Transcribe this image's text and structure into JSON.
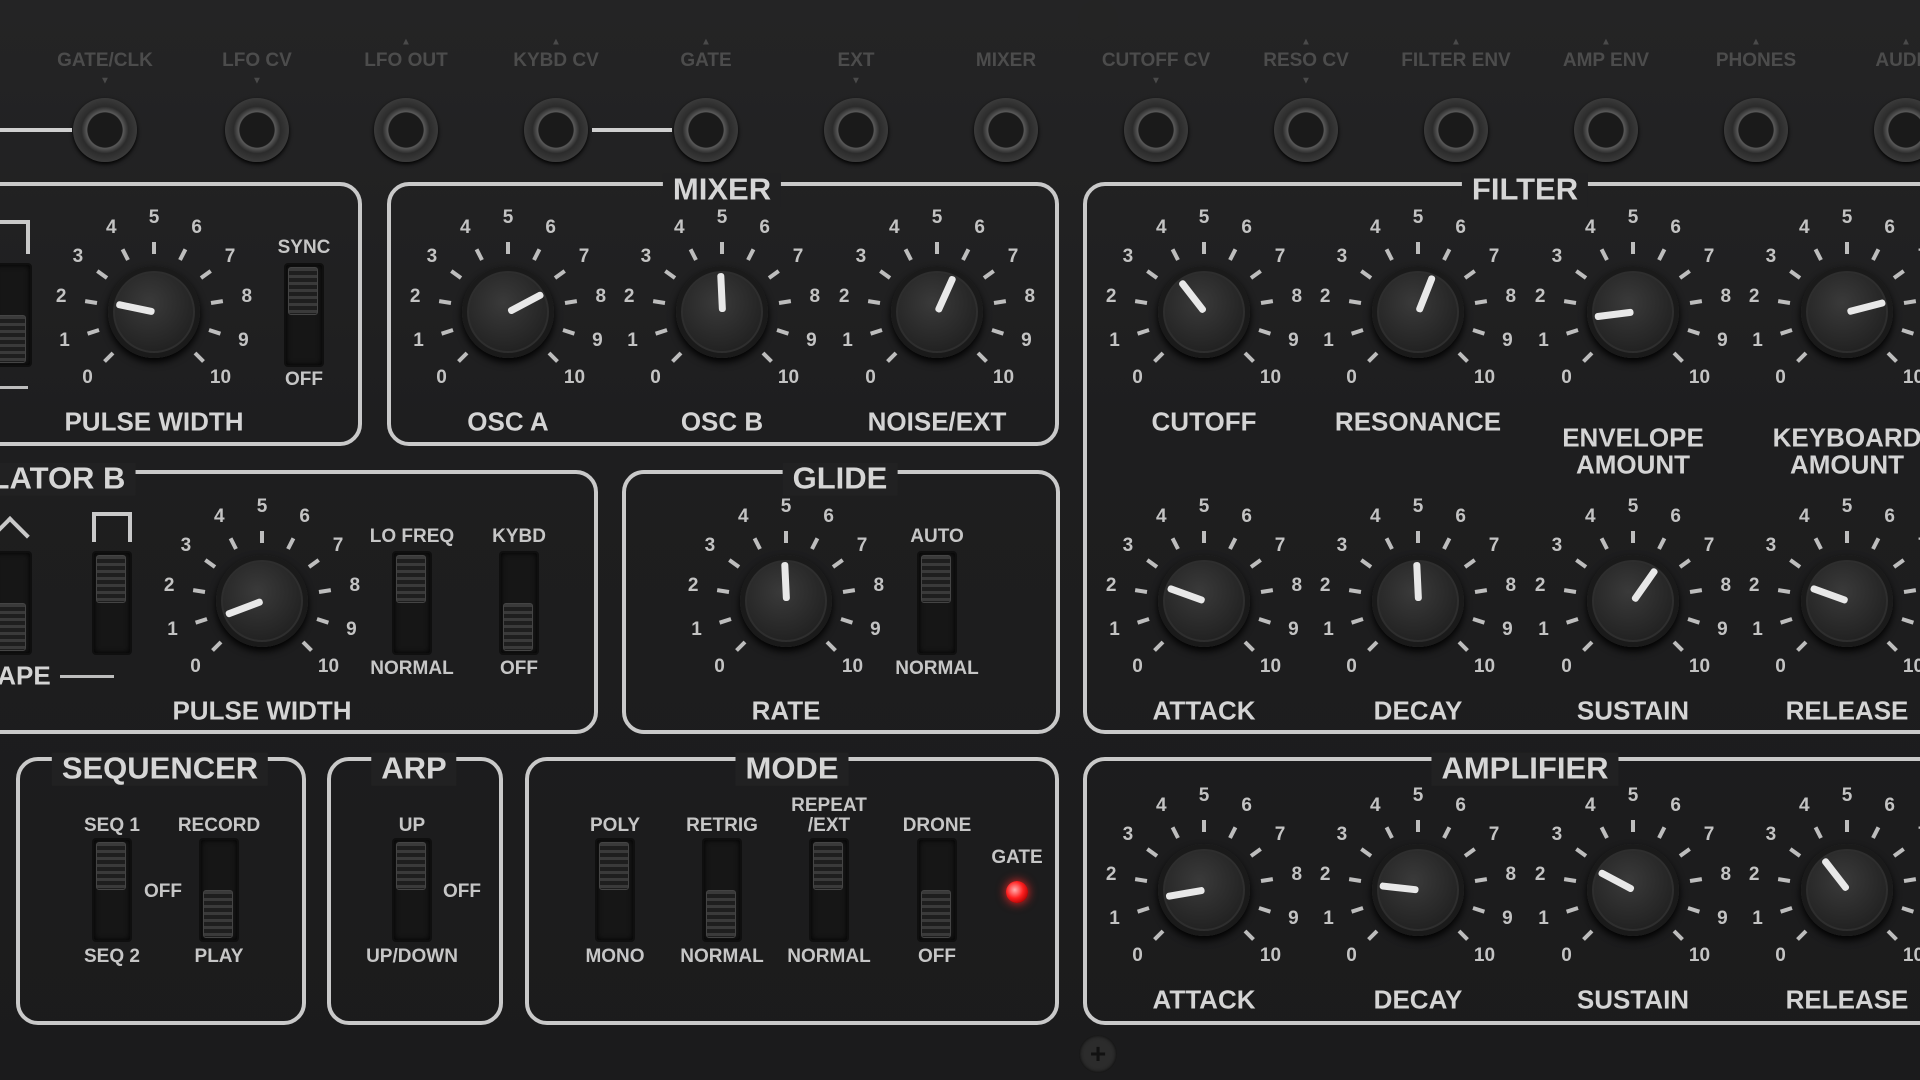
{
  "jacks": [
    "GATE/CLK",
    "LFO CV",
    "LFO OUT",
    "KYBD CV",
    "GATE",
    "EXT",
    "MIXER",
    "CUTOFF CV",
    "RESO CV",
    "FILTER ENV",
    "AMP ENV",
    "PHONES",
    "AUDIO"
  ],
  "scale": [
    "0",
    "1",
    "2",
    "3",
    "4",
    "5",
    "6",
    "7",
    "8",
    "9",
    "10"
  ],
  "sections": {
    "mixer": "MIXER",
    "filter": "FILTER",
    "osc_b": "LATOR B",
    "glide": "GLIDE",
    "sequencer": "SEQUENCER",
    "arp": "ARP",
    "mode": "MODE",
    "amplifier": "AMPLIFIER"
  },
  "knobs": [
    {
      "id": "osca-pulse-width",
      "label": "PULSE WIDTH",
      "value": 2.1
    },
    {
      "id": "mixer-osc-a",
      "label": "OSC A",
      "value": 7.3
    },
    {
      "id": "mixer-osc-b",
      "label": "OSC B",
      "value": 4.9
    },
    {
      "id": "mixer-noise-ext",
      "label": "NOISE/EXT",
      "value": 5.9
    },
    {
      "id": "filter-cutoff",
      "label": "CUTOFF",
      "value": 3.6
    },
    {
      "id": "filter-resonance",
      "label": "RESONANCE",
      "value": 5.8
    },
    {
      "id": "filter-env-amount",
      "label": "ENVELOPE AMOUNT",
      "value": 1.4
    },
    {
      "id": "filter-kbd-amount",
      "label": "KEYBOARD AMOUNT",
      "value": 7.8
    },
    {
      "id": "oscb-pulse-width",
      "label": "PULSE WIDTH",
      "value": 0.9
    },
    {
      "id": "glide-rate",
      "label": "RATE",
      "value": 4.9
    },
    {
      "id": "fenv-attack",
      "label": "ATTACK",
      "value": 2.4
    },
    {
      "id": "fenv-decay",
      "label": "DECAY",
      "value": 4.9
    },
    {
      "id": "fenv-sustain",
      "label": "SUSTAIN",
      "value": 6.3
    },
    {
      "id": "fenv-release",
      "label": "RELEASE",
      "value": 2.4
    },
    {
      "id": "amp-attack",
      "label": "ATTACK",
      "value": 1.3
    },
    {
      "id": "amp-decay",
      "label": "DECAY",
      "value": 1.9
    },
    {
      "id": "amp-sustain",
      "label": "SUSTAIN",
      "value": 2.7
    },
    {
      "id": "amp-release",
      "label": "RELEASE",
      "value": 3.6
    }
  ],
  "labels": {
    "sync": "SYNC",
    "off": "OFF",
    "lo_freq": "LO FREQ",
    "normal": "NORMAL",
    "kybd": "KYBD",
    "auto": "AUTO",
    "shape_frag": "APE",
    "seq1": "SEQ 1",
    "seq2": "SEQ 2",
    "record": "RECORD",
    "play": "PLAY",
    "up": "UP",
    "updown": "UP/DOWN",
    "poly": "POLY",
    "mono": "MONO",
    "retrig": "RETRIG",
    "repeat": "REPEAT /EXT",
    "drone": "DRONE",
    "gate": "GATE"
  },
  "switches": {
    "sync": "OFF",
    "lo_freq": "LO FREQ",
    "kybd": "OFF",
    "glide_auto": "AUTO",
    "sequencer": "OFF",
    "record_play": "PLAY",
    "arp": "OFF",
    "poly_mono": "POLY",
    "retrig": "NORMAL",
    "repeat_ext": "REPEAT /EXT",
    "drone": "OFF"
  },
  "gate_led": "on",
  "colors": {
    "panel": "#1e1e1f",
    "line": "#c9c9c9",
    "text": "#d4d4d4",
    "led": "#ff2020",
    "jack_label": "#4c4c4c"
  }
}
